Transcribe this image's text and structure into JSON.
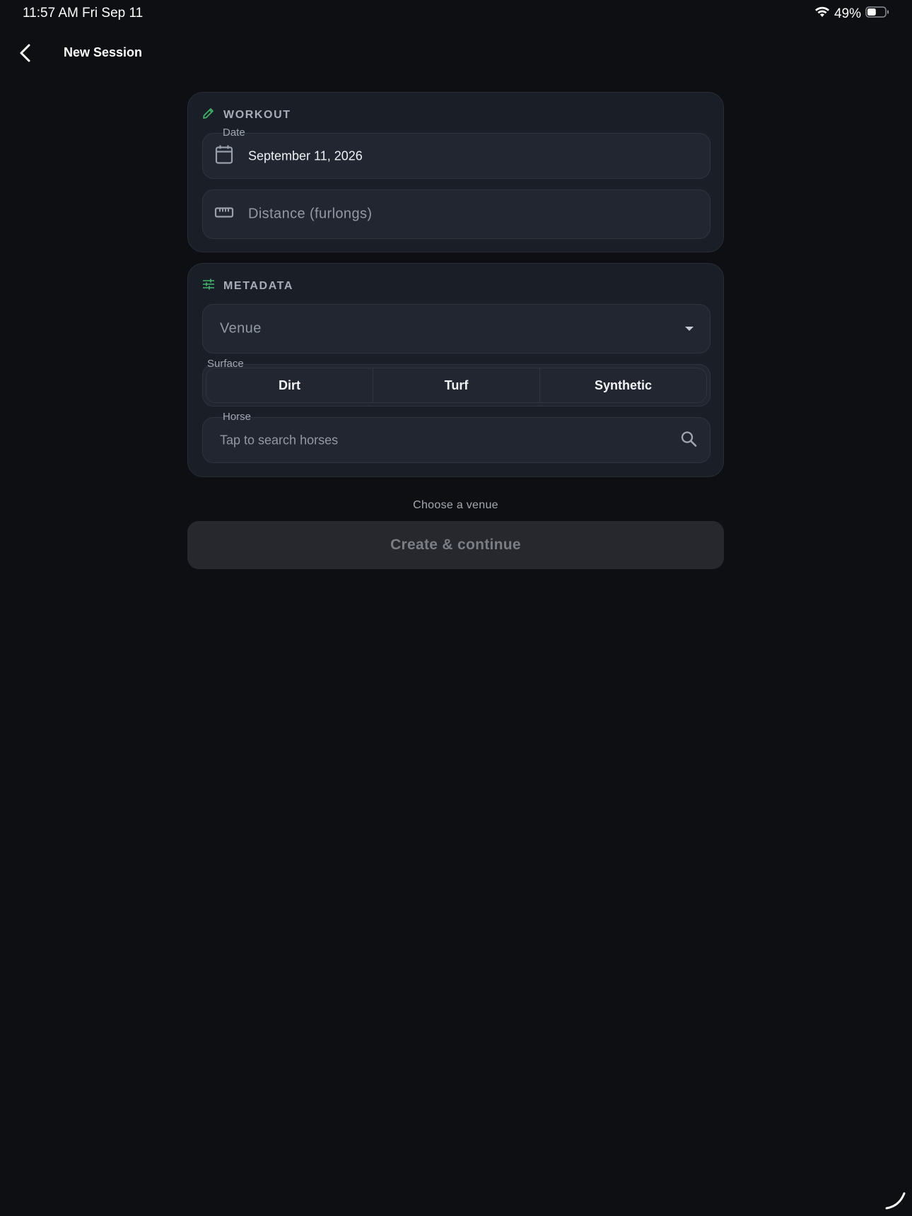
{
  "status_bar": {
    "time": "11:57 AM",
    "date": "Fri Sep 11",
    "battery_percent": "49%",
    "battery_level": 0.49
  },
  "nav": {
    "title": "New Session"
  },
  "workout": {
    "title": "WORKOUT",
    "date_label": "Date",
    "date_value": "September 11, 2026",
    "distance_placeholder": "Distance (furlongs)"
  },
  "metadata": {
    "title": "METADATA",
    "venue_placeholder": "Venue",
    "surface_label": "Surface",
    "surface_options": [
      "Dirt",
      "Turf",
      "Synthetic"
    ],
    "horse_label": "Horse",
    "horse_placeholder": "Tap to search horses"
  },
  "footer": {
    "hint": "Choose a venue",
    "cta_label": "Create & continue"
  },
  "colors": {
    "accent": "#3fb068",
    "background": "#0d0f13",
    "card": "#1a1e26",
    "field": "#212631"
  }
}
